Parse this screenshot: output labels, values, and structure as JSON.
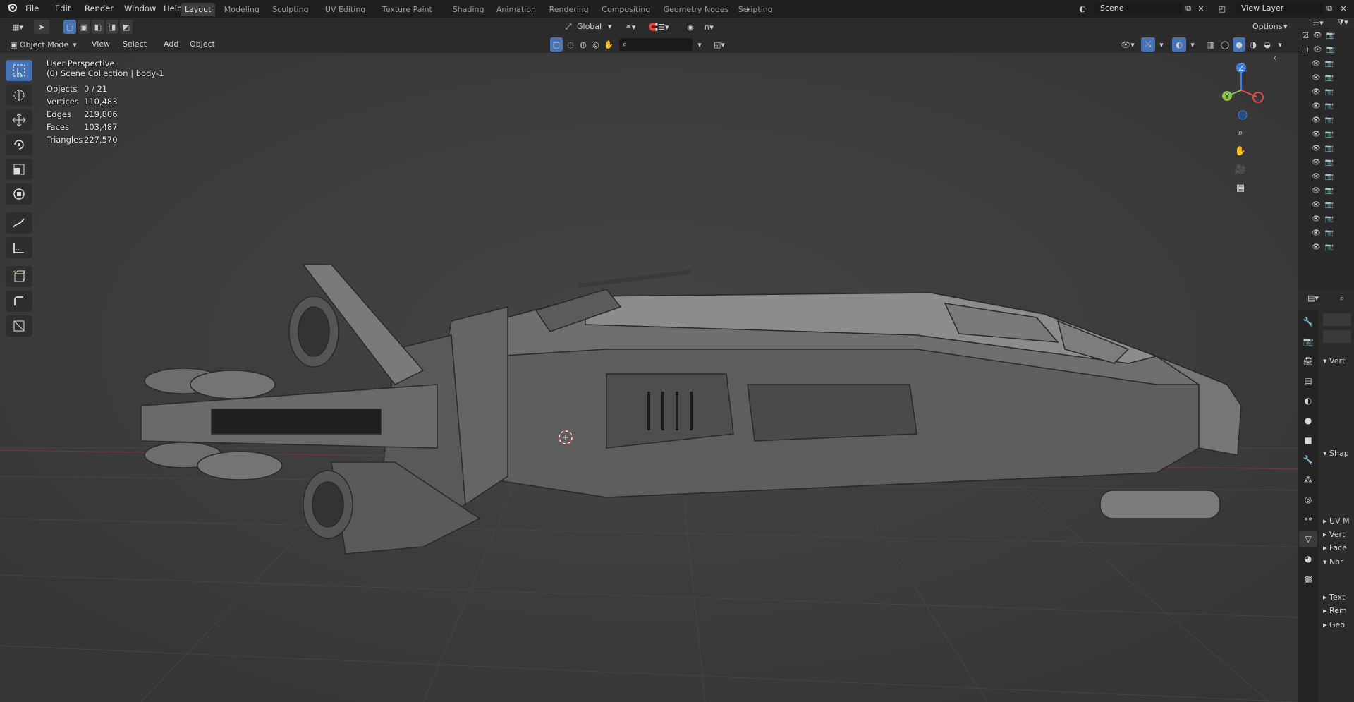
{
  "menus": [
    "File",
    "Edit",
    "Render",
    "Window",
    "Help"
  ],
  "workspaces": [
    "Layout",
    "Modeling",
    "Sculpting",
    "UV Editing",
    "Texture Paint",
    "Shading",
    "Animation",
    "Rendering",
    "Compositing",
    "Geometry Nodes",
    "Scripting"
  ],
  "active_workspace": "Layout",
  "scene_name": "Scene",
  "view_layer": "View Layer",
  "header": {
    "mode": "Object Mode",
    "menu": [
      "View",
      "Select",
      "Add",
      "Object"
    ],
    "orientation": "Global",
    "options": "Options"
  },
  "overlay_text": {
    "view_name": "User Perspective",
    "collection": "(0) Scene Collection | body-1"
  },
  "stats": [
    {
      "label": "Objects",
      "value": "0 / 21"
    },
    {
      "label": "Vertices",
      "value": "110,483"
    },
    {
      "label": "Edges",
      "value": "219,806"
    },
    {
      "label": "Faces",
      "value": "103,487"
    },
    {
      "label": "Triangles",
      "value": "227,570"
    }
  ],
  "gizmo": {
    "z": "Z",
    "y": "Y"
  },
  "props_sections": [
    {
      "label": "Vert",
      "expanded": true
    },
    {
      "label": "Shap",
      "expanded": true
    },
    {
      "label": "UV M",
      "expanded": false
    },
    {
      "label": "Vert",
      "expanded": false
    },
    {
      "label": "Face",
      "expanded": false
    },
    {
      "label": "Nor",
      "expanded": true
    },
    {
      "label": "Text",
      "expanded": false
    },
    {
      "label": "Rem",
      "expanded": false
    },
    {
      "label": "Geo",
      "expanded": false
    }
  ],
  "colors": {
    "accent": "#4772b3",
    "x_axis": "#e24a4a",
    "y_axis": "#8bc34a",
    "z_axis": "#3f7fe6"
  }
}
